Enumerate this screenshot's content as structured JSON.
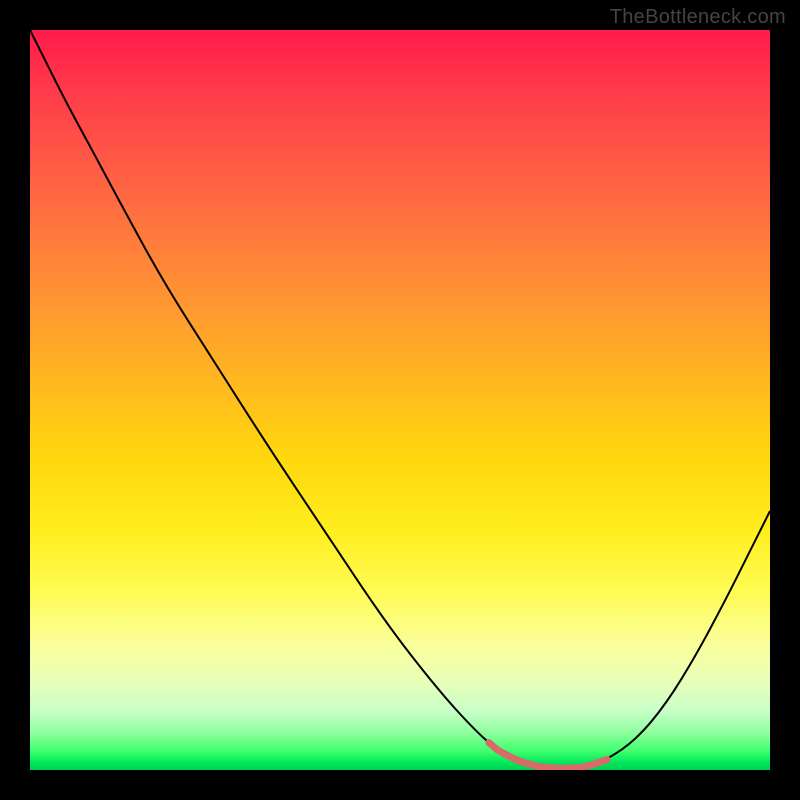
{
  "watermark": "TheBottleneck.com",
  "colors": {
    "background": "#000000",
    "curve": "#000000",
    "plateau": "#d96a6a",
    "gradient_top": "#ff1a4a",
    "gradient_mid": "#ffd80e",
    "gradient_bottom": "#00d050"
  },
  "chart_data": {
    "type": "line",
    "title": "",
    "xlabel": "",
    "ylabel": "",
    "xlim": [
      0,
      100
    ],
    "ylim": [
      0,
      100
    ],
    "grid": false,
    "x": [
      0,
      2,
      5,
      8,
      12,
      18,
      25,
      32,
      40,
      48,
      55,
      60,
      63,
      66,
      69,
      72,
      75,
      78,
      82,
      86,
      90,
      94,
      97,
      100
    ],
    "y": [
      100,
      96,
      90,
      84.5,
      77,
      66,
      55,
      44,
      32,
      20,
      11,
      5.5,
      2.8,
      1.2,
      0.4,
      0.2,
      0.4,
      1.4,
      4.2,
      9,
      15.5,
      23,
      29,
      35
    ],
    "plateau_range_x": [
      62,
      78
    ],
    "annotations": []
  }
}
